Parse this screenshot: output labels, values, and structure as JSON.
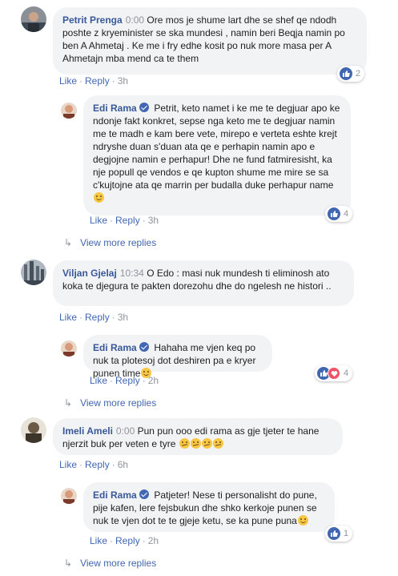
{
  "comments": [
    {
      "author": "Petrit Prenga",
      "timestamp": "0:00",
      "text": "Ore mos je shume lart dhe se shef qe ndodh poshte z kryeminister se ska mundesi , namin beri Beqja namin po ben A Ahmetaj . Ke me i fry edhe kosit po nuk more masa per A Ahmetajn mba mend ca te them",
      "like_label": "Like",
      "reply_label": "Reply",
      "age": "3h",
      "reaction_count": "2",
      "reply": {
        "author": "Edi Rama",
        "text": "Petrit, keto namet i ke me te degjuar apo ke ndonje fakt konkret, sepse nga keto me te degjuar namin me te madh e kam bere vete, mirepo e verteta eshte krejt ndryshe duan s'duan ata qe e perhapin namin apo e degjojne namin e perhapur! Dhe ne fund fatmiresisht, ka nje popull qe vendos e qe kupton shume me mire se sa c'kujtojne ata qe marrin per budalla duke perhapur name",
        "like_label": "Like",
        "reply_label": "Reply",
        "age": "3h",
        "reaction_count": "4"
      },
      "view_more": "View more replies"
    },
    {
      "author": "Viljan Gjelaj",
      "timestamp": "10:34",
      "text": "O Edo : masi nuk mundesh ti eliminosh ato koka te djegura te pakten dorezohu dhe do ngelesh ne histori ..",
      "like_label": "Like",
      "reply_label": "Reply",
      "age": "3h",
      "reply": {
        "author": "Edi Rama",
        "text": "Hahaha me vjen keq po nuk ta plotesoj dot deshiren pa e kryer punen time",
        "like_label": "Like",
        "reply_label": "Reply",
        "age": "2h",
        "reaction_count": "4"
      },
      "view_more": "View more replies"
    },
    {
      "author": "Imeli Ameli",
      "timestamp": "0:00",
      "text": "Pun pun ooo edi rama as gje tjeter te hane njerzit buk per veten e tyre",
      "like_label": "Like",
      "reply_label": "Reply",
      "age": "6h",
      "reply": {
        "author": "Edi Rama",
        "text": "Patjeter! Nese ti personalisht do pune, pije kafen, lere fejsbukun dhe shko kerkoje punen se nuk te vjen dot te te gjeje ketu, se ka pune puna",
        "like_label": "Like",
        "reply_label": "Reply",
        "age": "2h",
        "reaction_count": "1"
      },
      "view_more": "View more replies"
    }
  ],
  "colors": {
    "link": "#4267b2",
    "name": "#385898",
    "bubble": "#f2f3f5",
    "muted": "#90949c",
    "like_icon": "#4267b2",
    "love_icon": "#f25268"
  }
}
